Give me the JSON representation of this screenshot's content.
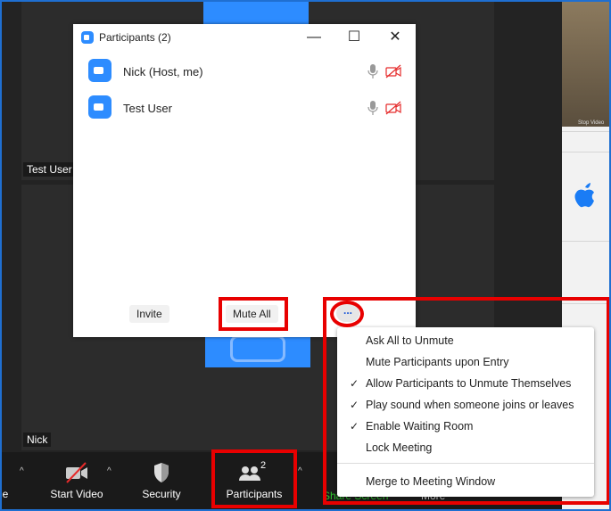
{
  "stage": {
    "tiles": [
      {
        "name_tag": "Test User"
      },
      {
        "name_tag": "Nick"
      }
    ]
  },
  "participants_window": {
    "title": "Participants (2)",
    "controls": {
      "minimize": "—",
      "maximize": "☐",
      "close": "✕"
    },
    "participants": [
      {
        "name": "Nick (Host, me)",
        "mic": "muted-mic-icon",
        "video": "video-off-icon"
      },
      {
        "name": "Test User",
        "mic": "muted-mic-icon",
        "video": "video-off-icon"
      }
    ],
    "invite_label": "Invite",
    "mute_all_label": "Mute All",
    "more_label": "..."
  },
  "more_menu": {
    "items": [
      {
        "label": "Ask All to Unmute",
        "checked": false
      },
      {
        "label": "Mute Participants upon Entry",
        "checked": false
      },
      {
        "label": "Allow Participants to Unmute Themselves",
        "checked": true
      },
      {
        "label": "Play sound when someone joins or leaves",
        "checked": true
      },
      {
        "label": "Enable Waiting Room",
        "checked": true
      },
      {
        "label": "Lock Meeting",
        "checked": false
      }
    ],
    "footer_item": "Merge to Meeting Window",
    "check_glyph": "✓"
  },
  "toolbar": {
    "edge_label": "e",
    "start_video_label": "Start Video",
    "security_label": "Security",
    "participants_label": "Participants",
    "participants_count": "2",
    "share_screen_label": "Share Screen",
    "more_label": "More",
    "caret": "^"
  },
  "right_panel": {
    "stop_video_label": "Stop Video"
  },
  "colors": {
    "zoom_blue": "#2d8cff",
    "highlight_red": "#e80000",
    "toolbar_bg": "#1a1a1a",
    "share_green": "#2cc42c"
  }
}
